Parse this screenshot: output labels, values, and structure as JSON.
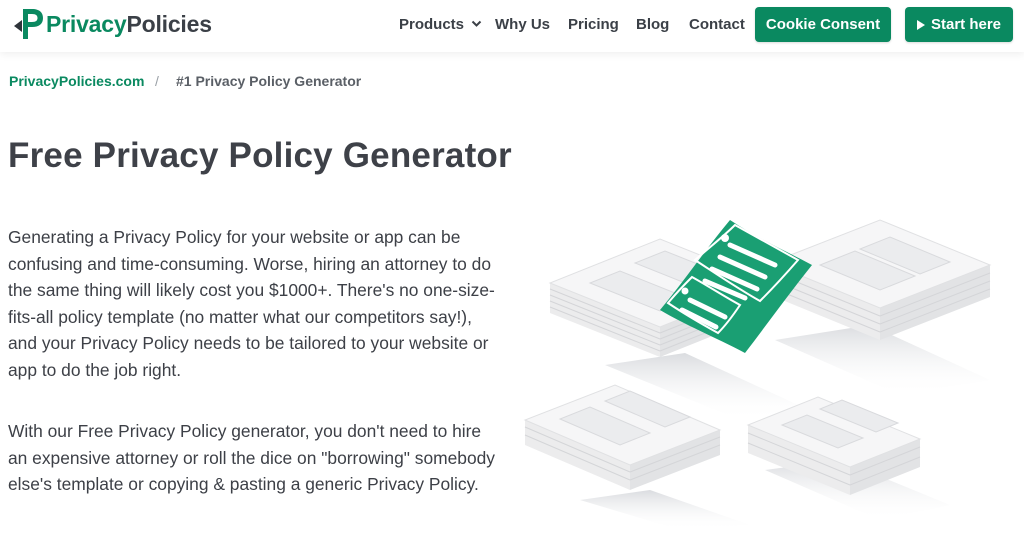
{
  "brand": {
    "name_part1": "Privacy",
    "name_part2": "Policies",
    "color_primary": "#0a8960",
    "color_text": "#3b4047"
  },
  "nav": {
    "items": [
      {
        "label": "Products",
        "icon": "chevron-down-icon"
      },
      {
        "label": "Why Us"
      },
      {
        "label": "Pricing"
      },
      {
        "label": "Blog"
      },
      {
        "label": "Contact"
      }
    ],
    "cookie_button": "Cookie Consent",
    "start_button": "Start here",
    "start_icon": "play-icon"
  },
  "breadcrumb": {
    "home": "PrivacyPolicies.com",
    "separator": "/",
    "current": "#1 Privacy Policy Generator"
  },
  "main": {
    "title": "Free Privacy Policy Generator",
    "paragraph1": "Generating a Privacy Policy for your website or app can be confusing and time-consuming. Worse, hiring an attorney to do the same thing will likely cost you $1000+. There's no one-size-fits-all policy template (no matter what our competitors say!), and your Privacy Policy needs to be tailored to your website or app to do the job right.",
    "paragraph2": "With our Free Privacy Policy generator, you don't need to hire an expensive attorney or roll the dice on \"borrowing\" somebody else's template or copying & pasting a generic Privacy Policy.",
    "illustration_icon": "document-stacks-illustration"
  }
}
